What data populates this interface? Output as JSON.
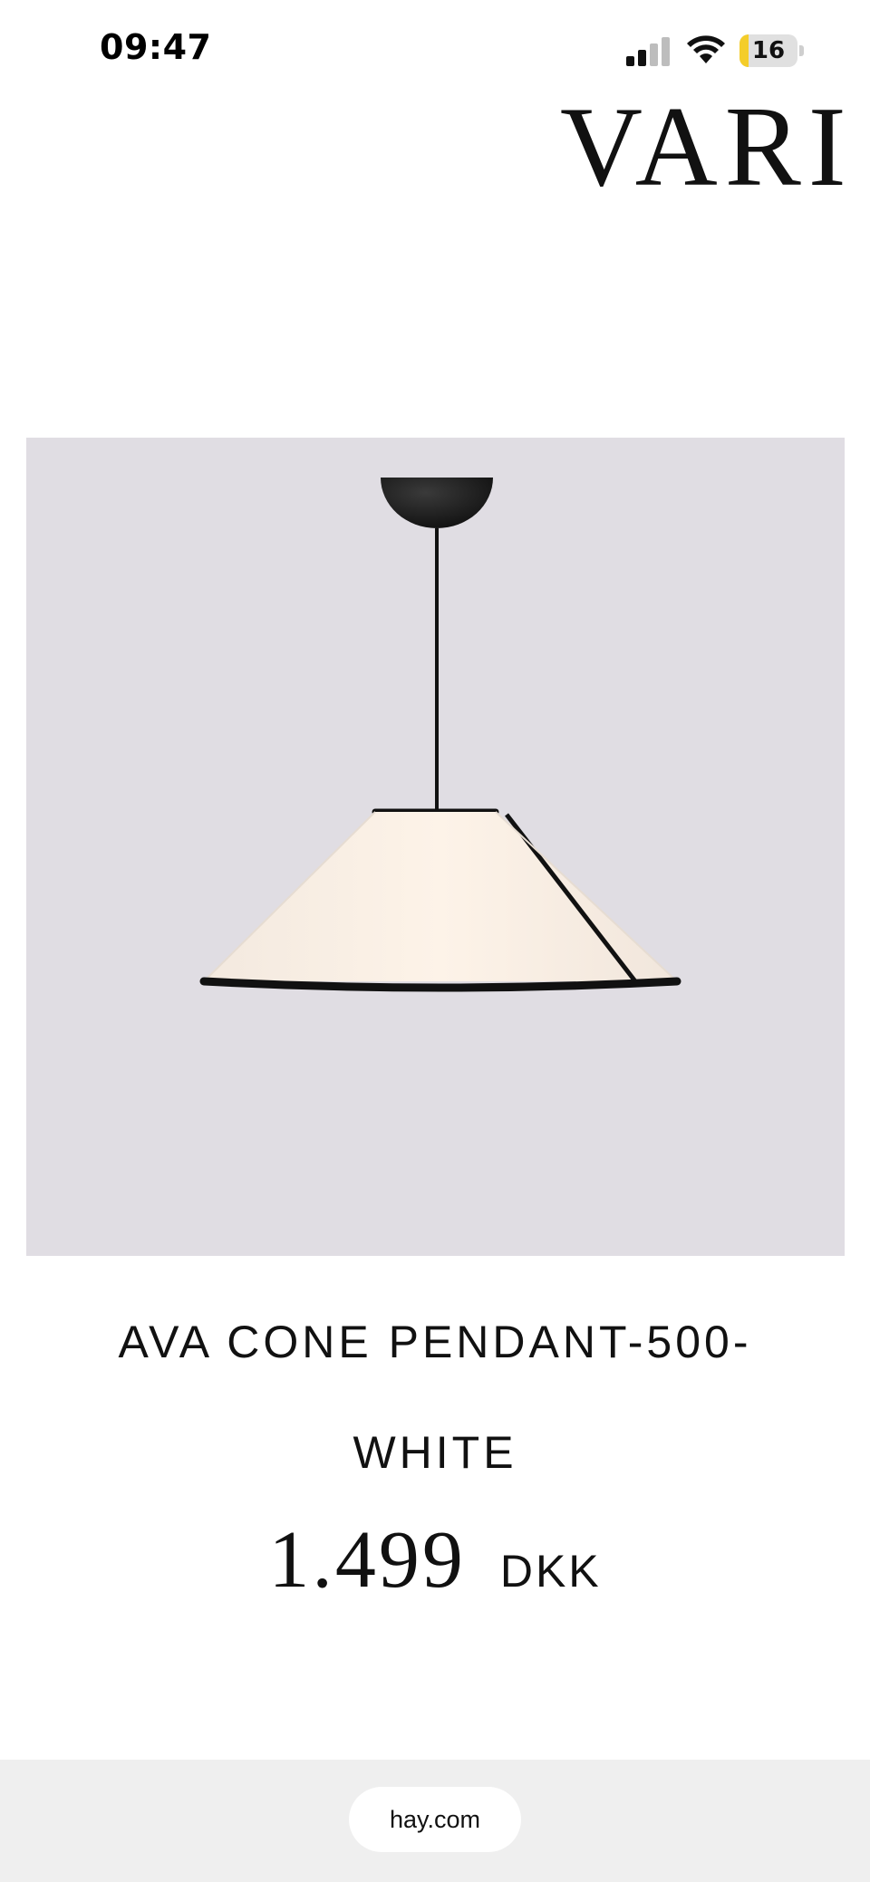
{
  "status_bar": {
    "time": "09:47",
    "battery_level": "16",
    "battery_fraction": 0.16,
    "signal_bars_active": 2,
    "signal_bars_total": 4,
    "icons": [
      "signal-icon",
      "wifi-icon",
      "battery-icon"
    ]
  },
  "header": {
    "brand_text": "VARI"
  },
  "product": {
    "image_name": "product-image-ava-cone-pendant",
    "title": "AVA CONE PENDANT-500-WHITE",
    "price": "1.499",
    "currency": "DKK"
  },
  "browser": {
    "url": "hay.com"
  },
  "colors": {
    "image_background": "#e0dde3",
    "battery_fill": "#f4cd2a",
    "browser_bar": "#efefef"
  }
}
